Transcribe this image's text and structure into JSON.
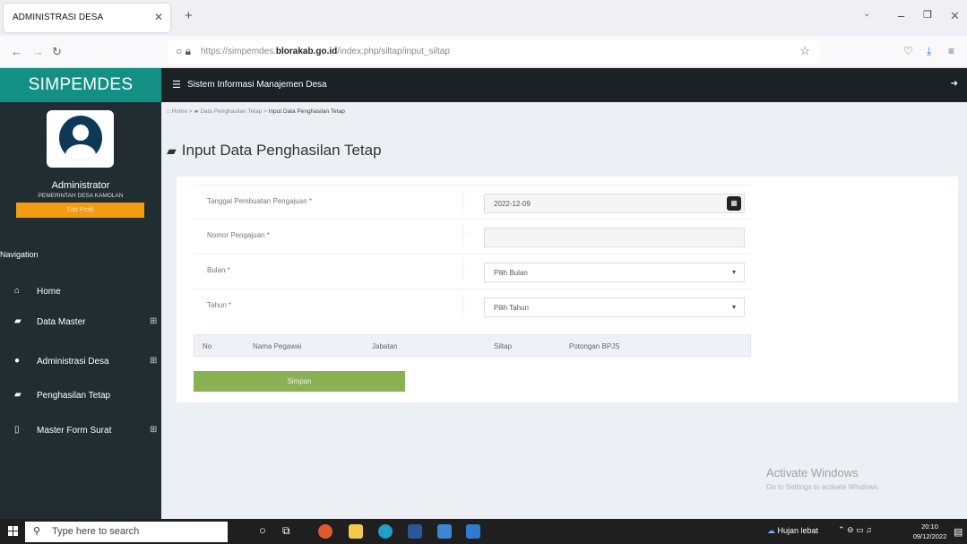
{
  "browser": {
    "tab_title": "ADMINISTRASI DESA",
    "url_prefix": "https://simpemdes.",
    "url_domain": "blorakab.go.id",
    "url_path": "/index.php/siltap/input_siltap"
  },
  "app": {
    "brand": "SIMPEMDES",
    "header_title": "Sistem Informasi Manajemen Desa"
  },
  "user": {
    "name": "Administrator",
    "org": "PEMERINTAH DESA KAMOLAN",
    "edit_profile": "Edit Profil"
  },
  "sidebar": {
    "nav_label": "Navigation",
    "items": [
      {
        "label": "Home",
        "icon": "home-icon",
        "expandable": false
      },
      {
        "label": "Data Master",
        "icon": "book-icon",
        "expandable": true
      },
      {
        "label": "Administrasi Desa",
        "icon": "user-icon",
        "expandable": true
      },
      {
        "label": "Penghasilan Tetap",
        "icon": "book-icon",
        "expandable": false
      },
      {
        "label": "Master Form Surat",
        "icon": "file-icon",
        "expandable": true
      }
    ]
  },
  "breadcrumb": {
    "home": "Home",
    "parent": "Data Penghasilan Tetap",
    "current": "Input Data Penghasilan Tetap"
  },
  "page": {
    "title": "Input Data Penghasilan Tetap"
  },
  "form": {
    "tanggal": {
      "label": "Tanggal Pembuatan Pengajuan *",
      "value": "2022-12-09"
    },
    "nomor": {
      "label": "Nomor Pengajuan *",
      "value": ""
    },
    "bulan": {
      "label": "Bulan *",
      "value": "Pilih Bulan"
    },
    "tahun": {
      "label": "Tahun *",
      "value": "Pilih Tahun"
    },
    "separator": ":"
  },
  "table": {
    "headers": [
      "No",
      "Nama Pegawai",
      "Jabatan",
      "Siltap",
      "Potongan BPJS"
    ]
  },
  "buttons": {
    "simpan": "Simpan"
  },
  "watermark": {
    "line1": "Activate Windows",
    "line2": "Go to Settings to activate Windows."
  },
  "taskbar": {
    "search_placeholder": "Type here to search",
    "weather": "Hujan lebat",
    "time": "20:10",
    "date": "09/12/2022"
  },
  "colors": {
    "brand_bg": "#139084",
    "sidebar_bg": "#222d32",
    "edit_profile_bg": "#f39c12",
    "save_button_bg": "#8bb155"
  }
}
